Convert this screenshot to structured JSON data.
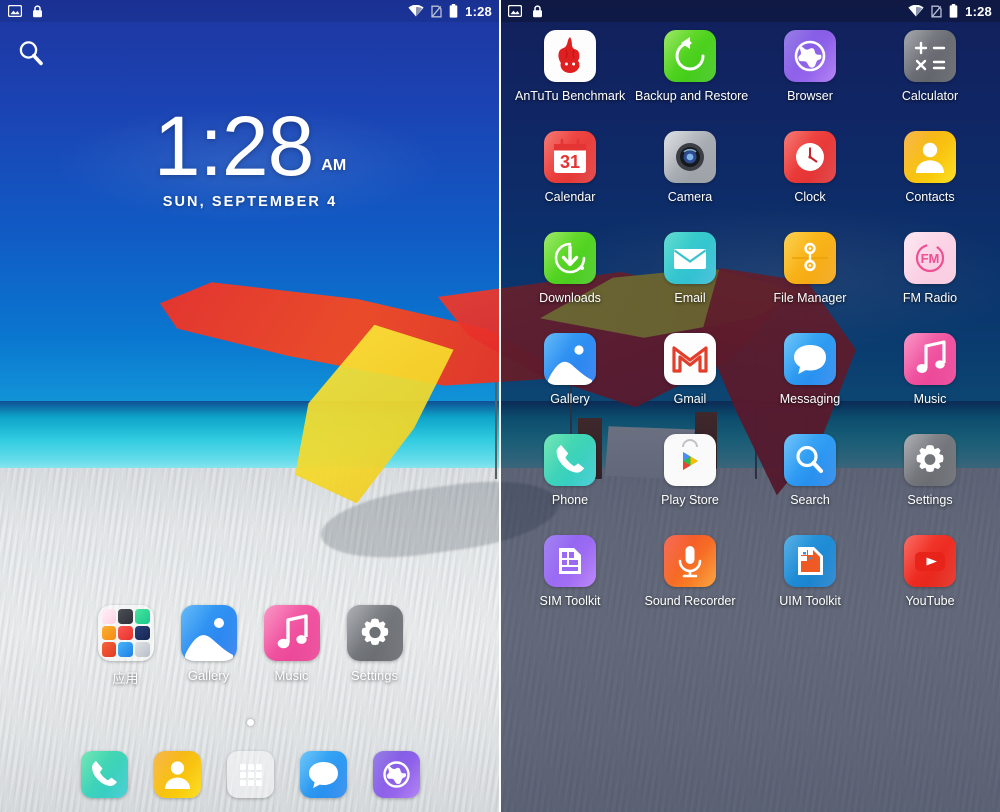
{
  "status_bar": {
    "left_icons": [
      "image-icon",
      "lock-icon"
    ],
    "right_icons": [
      "wifi-icon",
      "sim-missing-icon",
      "battery-icon"
    ],
    "time": "1:28"
  },
  "home_screen": {
    "search_icon": "search-icon",
    "clock_widget": {
      "time": "1:28",
      "ampm": "AM",
      "date": "SUN, SEPTEMBER 4"
    },
    "apps": [
      {
        "label": "应用",
        "icon": "folder-icon"
      },
      {
        "label": "Gallery",
        "icon": "gallery-icon"
      },
      {
        "label": "Music",
        "icon": "music-icon"
      },
      {
        "label": "Settings",
        "icon": "settings-icon"
      }
    ],
    "dock": [
      {
        "label": "Phone",
        "icon": "phone-icon"
      },
      {
        "label": "Contacts",
        "icon": "contacts-icon"
      },
      {
        "label": "App Drawer",
        "icon": "app-drawer-icon"
      },
      {
        "label": "Messaging",
        "icon": "messaging-icon"
      },
      {
        "label": "Browser",
        "icon": "browser-icon"
      }
    ],
    "page_indicator_dots": 1
  },
  "app_drawer": {
    "apps": [
      {
        "label": "AnTuTu Benchmark",
        "icon": "antutu-icon"
      },
      {
        "label": "Backup and Restore",
        "icon": "backup-restore-icon"
      },
      {
        "label": "Browser",
        "icon": "browser-icon"
      },
      {
        "label": "Calculator",
        "icon": "calculator-icon"
      },
      {
        "label": "Calendar",
        "icon": "calendar-icon"
      },
      {
        "label": "Camera",
        "icon": "camera-icon"
      },
      {
        "label": "Clock",
        "icon": "clock-icon"
      },
      {
        "label": "Contacts",
        "icon": "contacts-icon"
      },
      {
        "label": "Downloads",
        "icon": "downloads-icon"
      },
      {
        "label": "Email",
        "icon": "email-icon"
      },
      {
        "label": "File Manager",
        "icon": "file-manager-icon"
      },
      {
        "label": "FM Radio",
        "icon": "fm-radio-icon"
      },
      {
        "label": "Gallery",
        "icon": "gallery-icon"
      },
      {
        "label": "Gmail",
        "icon": "gmail-icon"
      },
      {
        "label": "Messaging",
        "icon": "messaging-icon"
      },
      {
        "label": "Music",
        "icon": "music-icon"
      },
      {
        "label": "Phone",
        "icon": "phone-icon"
      },
      {
        "label": "Play Store",
        "icon": "play-store-icon"
      },
      {
        "label": "Search",
        "icon": "search-icon"
      },
      {
        "label": "Settings",
        "icon": "settings-icon"
      },
      {
        "label": "SIM Toolkit",
        "icon": "sim-toolkit-icon"
      },
      {
        "label": "Sound Recorder",
        "icon": "sound-recorder-icon"
      },
      {
        "label": "UIM Toolkit",
        "icon": "uim-toolkit-icon"
      },
      {
        "label": "YouTube",
        "icon": "youtube-icon"
      }
    ]
  },
  "calendar_icon_day": "31",
  "fm_label": "FM",
  "colors": {
    "sky": "#1b43b3",
    "sea": "#2fcbe0",
    "sand": "#e6e9ea",
    "fabric_red": "#e8332c",
    "fabric_yellow": "#f5d827",
    "drawer_overlay": "#0a122e",
    "status_text": "#ffffff"
  }
}
